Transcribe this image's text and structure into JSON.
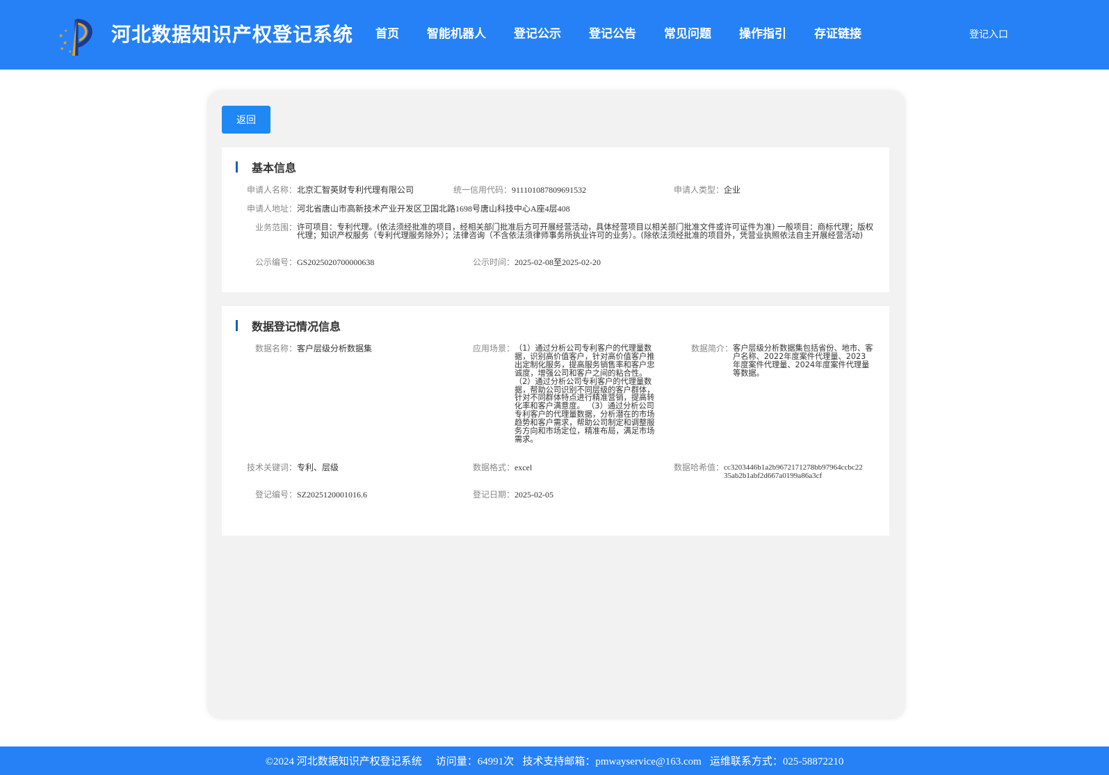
{
  "header": {
    "title": "河北数据知识产权登记系统",
    "nav": [
      "首页",
      "智能机器人",
      "登记公示",
      "登记公告",
      "常见问题",
      "操作指引",
      "存证链接"
    ],
    "login": "登记入口"
  },
  "back_button": "返回",
  "basic": {
    "title": "基本信息",
    "applicant_name_label": "申请人名称：",
    "applicant_name": "北京汇智英财专利代理有限公司",
    "credit_code_label": "统一信用代码：",
    "credit_code": "911101087809691532",
    "applicant_type_label": "申请人类型：",
    "applicant_type": "企业",
    "address_label": "申请人地址：",
    "address": "河北省唐山市高新技术产业开发区卫国北路1698号唐山科技中心A座4层408",
    "scope_label": "业务范围：",
    "scope": "许可项目：专利代理。(依法须经批准的项目，经相关部门批准后方可开展经营活动，具体经营项目以相关部门批准文件或许可证件为准) 一般项目：商标代理；版权代理；知识产权服务（专利代理服务除外）；法律咨询（不含依法须律师事务所执业许可的业务）。(除依法须经批准的项目外，凭营业执照依法自主开展经营活动)",
    "pub_no_label": "公示编号：",
    "pub_no": "GS2025020700000638",
    "pub_time_label": "公示时间：",
    "pub_time": "2025-02-08至2025-02-20"
  },
  "data_reg": {
    "title": "数据登记情况信息",
    "name_label": "数据名称：",
    "name": "客户层级分析数据集",
    "scene_label": "应用场景：",
    "scene": "（1）通过分析公司专利客户的代理量数据，识别高价值客户，针对高价值客户推出定制化服务，提高服务销售率和客户忠诚度，增强公司和客户之间的粘合性。 （2）通过分析公司专利客户的代理量数据，帮助公司识别不同层级的客户群体，针对不同群体特点进行精准营销，提高转化率和客户满意度。 （3）通过分析公司专利客户的代理量数据，分析潜在的市场趋势和客户需求，帮助公司制定和调整服务方向和市场定位，精准布局，满足市场需求。",
    "intro_label": "数据简介：",
    "intro": "客户层级分析数据集包括省份、地市、客户名称、2022年度案件代理量、2023年度案件代理量、2024年度案件代理量等数据。",
    "keywords_label": "技术关键词：",
    "keywords": "专利、层级",
    "format_label": "数据格式：",
    "format": "excel",
    "hash_label": "数据哈希值：",
    "hash": "cc3203446b1a2b9672171278bb97964ccbc2235ab2b1abf2d667a0199a86a3cf",
    "reg_no_label": "登记编号：",
    "reg_no": "SZ2025120001016.6",
    "reg_date_label": "登记日期：",
    "reg_date": "2025-02-05"
  },
  "footer": {
    "copyright": "©2024 河北数据知识产权登记系统",
    "visits": "访问量：64991次",
    "email": "技术支持邮箱：pmwayservice@163.com",
    "contact": "运维联系方式：025-58872210"
  },
  "colors": {
    "header": "#2581f5",
    "button": "#1e88f5",
    "panel": "#f2f2f2",
    "section_bar": "#1b5fb0"
  }
}
